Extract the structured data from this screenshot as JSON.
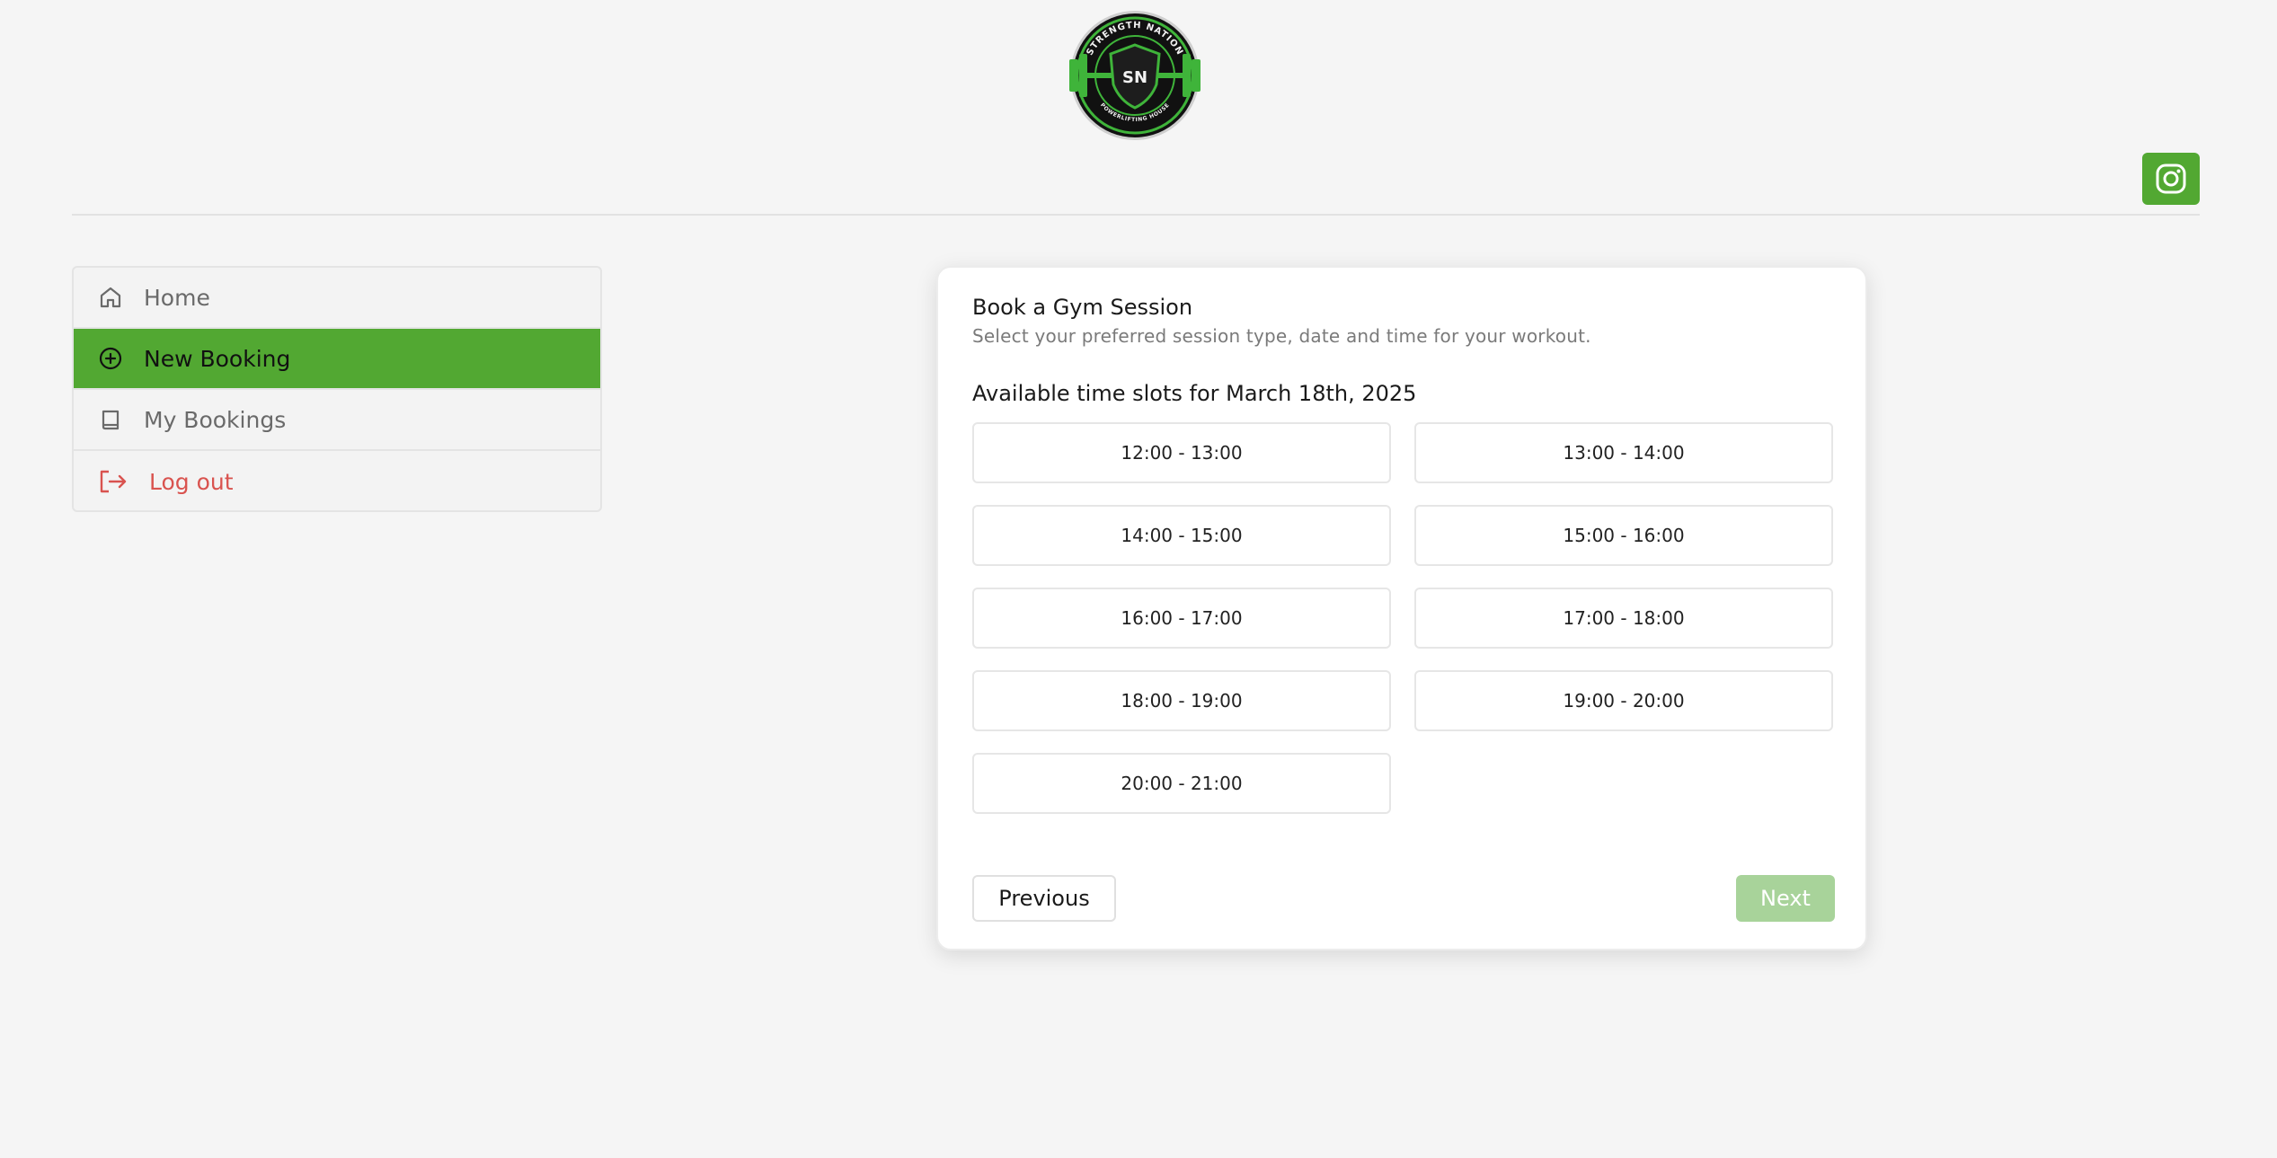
{
  "brand": {
    "logo_top_text": "STRENGTH NATION",
    "logo_monogram": "SN",
    "logo_bottom_text": "POWERLIFTING HOUSE",
    "accent_color": "#52a832",
    "logout_color": "#d9534f"
  },
  "header": {
    "instagram_icon": "instagram-icon"
  },
  "sidebar": {
    "items": [
      {
        "label": "Home",
        "icon": "home-icon",
        "active": false
      },
      {
        "label": "New Booking",
        "icon": "plus-circle-icon",
        "active": true
      },
      {
        "label": "My Bookings",
        "icon": "book-icon",
        "active": false
      },
      {
        "label": "Log out",
        "icon": "logout-icon",
        "active": false
      }
    ]
  },
  "booking": {
    "title": "Book a Gym Session",
    "subtitle": "Select your preferred session type, date and time for your workout.",
    "slots_heading": "Available time slots for March 18th, 2025",
    "slots": [
      "12:00 - 13:00",
      "13:00 - 14:00",
      "14:00 - 15:00",
      "15:00 - 16:00",
      "16:00 - 17:00",
      "17:00 - 18:00",
      "18:00 - 19:00",
      "19:00 - 20:00",
      "20:00 - 21:00"
    ],
    "previous_label": "Previous",
    "next_label": "Next"
  }
}
